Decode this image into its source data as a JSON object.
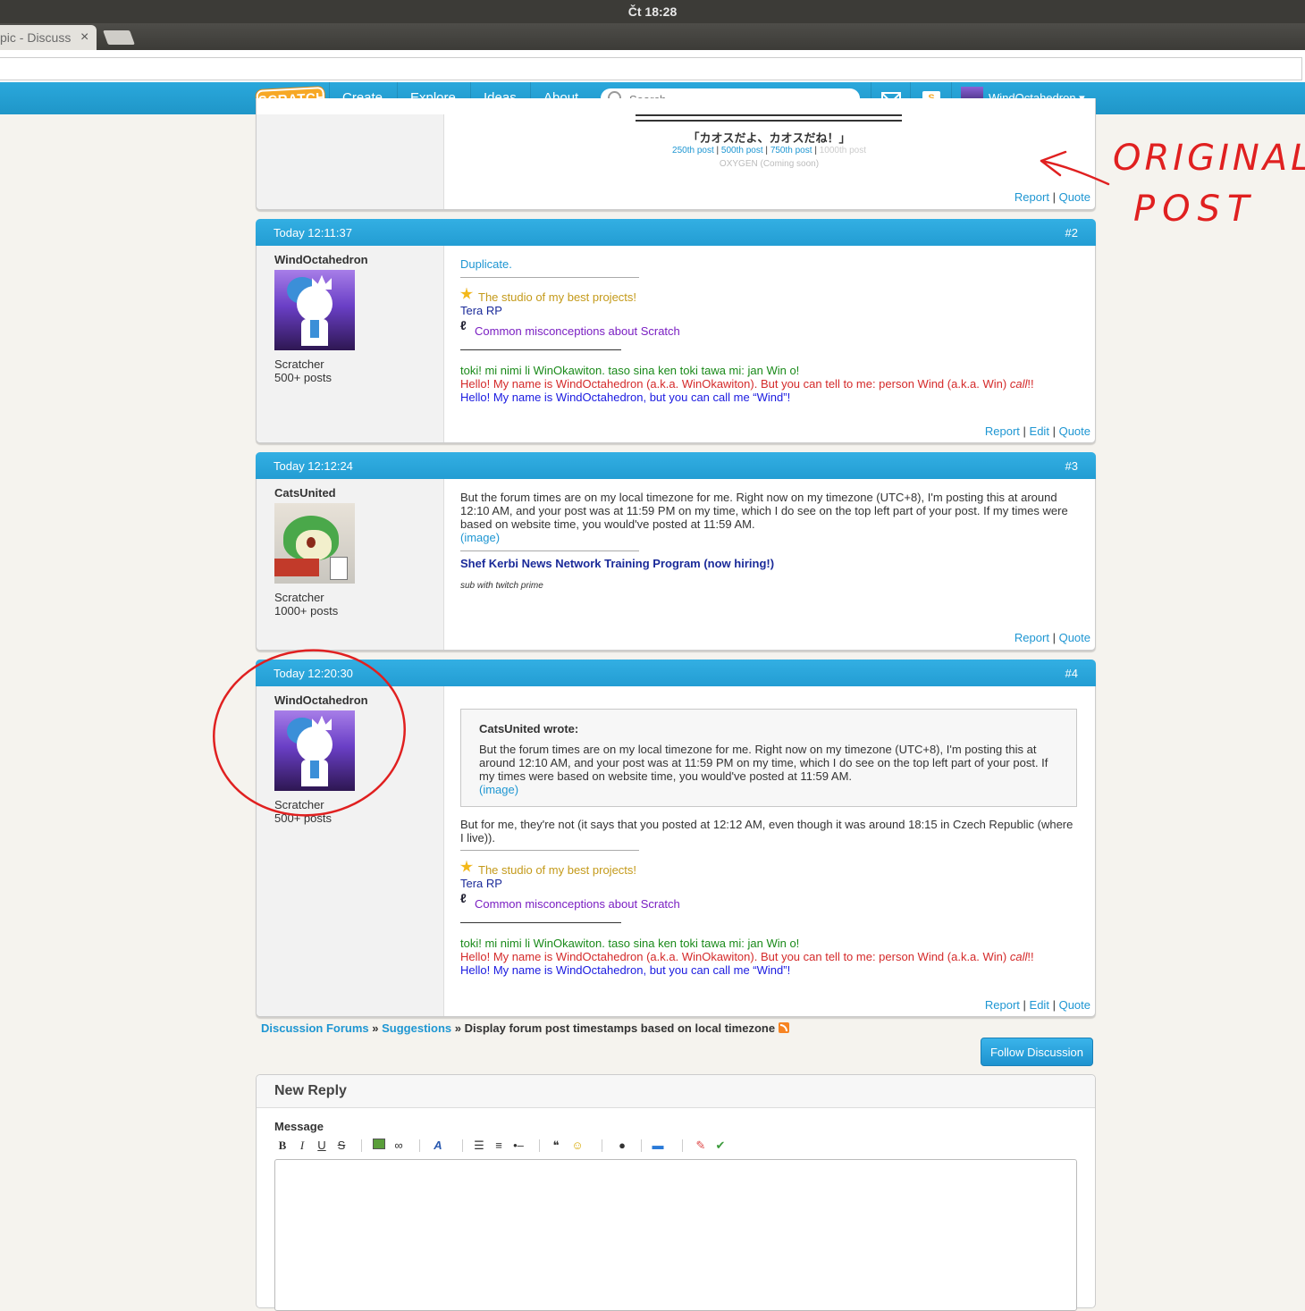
{
  "os_bar": {
    "clock": "Čt 18:28"
  },
  "browser": {
    "tab_title": "pic - Discuss",
    "tab_close": "×"
  },
  "nav": {
    "logo": "SCRATCH",
    "items": [
      "Create",
      "Explore",
      "Ideas",
      "About"
    ],
    "search_placeholder": "Search",
    "user": "WindOctahedron ▾"
  },
  "post1": {
    "signature_title": "「カオスだよ、カオスだね！」",
    "milestones": [
      "250th post",
      "500th post",
      "750th post",
      "1000th post"
    ],
    "milestone_seps": [
      "|",
      "|",
      "|"
    ],
    "oxygen": "OXYGEN (Coming soon)",
    "actions": [
      "Report",
      "Quote"
    ],
    "action_sep": "|"
  },
  "post2": {
    "time": "Today 12:11:37",
    "num": "#2",
    "author": "WindOctahedron",
    "rank": "Scratcher",
    "posts": "500+ posts",
    "message": "Duplicate.",
    "sig_studio": "The studio of my best projects!",
    "sig_tera": "Tera RP",
    "sig_misconceptions": "Common misconceptions about Scratch",
    "sig_toki": "toki! mi nimi li WinOkawiton. taso sina ken toki tawa mi: jan Win o!",
    "sig_hello_red": "Hello! My name is WindOctahedron (a.k.a. WinOkawiton). But you can tell to me: person Wind (a.k.a. Win) ",
    "sig_hello_red_em": "call",
    "sig_hello_red_end": "!!",
    "sig_hello_blue": "Hello! My name is WindOctahedron, but you can call me “Wind”!",
    "actions": [
      "Report",
      "Edit",
      "Quote"
    ],
    "action_sep": "|"
  },
  "post3": {
    "time": "Today 12:12:24",
    "num": "#3",
    "author": "CatsUnited",
    "rank": "Scratcher",
    "posts": "1000+ posts",
    "message": "But the forum times are on my local timezone for me. Right now on my timezone (UTC+8), I'm posting this at around 12:10 AM, and your post was at 11:59 PM on my time, which I do see on the top left part of your post. If my times were based on website time, you would've posted at 11:59 AM.",
    "image_link": "(image)",
    "sig_news": "Shef Kerbi News Network Training Program (now hiring!)",
    "sig_twitch": "sub with twitch prime",
    "actions": [
      "Report",
      "Quote"
    ],
    "action_sep": "|"
  },
  "post4": {
    "time": "Today 12:20:30",
    "num": "#4",
    "author": "WindOctahedron",
    "rank": "Scratcher",
    "posts": "500+ posts",
    "quote_author": "CatsUnited wrote:",
    "quote_text": "But the forum times are on my local timezone for me. Right now on my timezone (UTC+8), I'm posting this at around 12:10 AM, and your post was at 11:59 PM on my time, which I do see on the top left part of your post. If my times were based on website time, you would've posted at 11:59 AM.",
    "quote_image": "(image)",
    "message": "But for me, they're not (it says that you posted at 12:12 AM, even though it was around 18:15 in Czech Republic (where I live)).",
    "sig_studio": "The studio of my best projects!",
    "sig_tera": "Tera RP",
    "sig_misconceptions": "Common misconceptions about Scratch",
    "sig_toki": "toki! mi nimi li WinOkawiton. taso sina ken toki tawa mi: jan Win o!",
    "sig_hello_red": "Hello! My name is WindOctahedron (a.k.a. WinOkawiton). But you can tell to me: person Wind (a.k.a. Win) ",
    "sig_hello_red_em": "call",
    "sig_hello_red_end": "!!",
    "sig_hello_blue": "Hello! My name is WindOctahedron, but you can call me “Wind”!",
    "actions": [
      "Report",
      "Edit",
      "Quote"
    ],
    "action_sep": "|"
  },
  "breadcrumb": {
    "forums": "Discussion Forums",
    "sep1": " » ",
    "suggestions": "Suggestions",
    "sep2": " » ",
    "topic": "Display forum post timestamps based on local timezone"
  },
  "follow_button": "Follow Discussion",
  "reply": {
    "title": "New Reply",
    "message_label": "Message",
    "toolbar": {
      "bold": "B",
      "italic": "I",
      "underline": "U",
      "strike": "S"
    }
  },
  "annotation": {
    "text_line1": "ORIGINAL",
    "text_line2": "POST",
    "color": "#e02020"
  },
  "colors": {
    "accent": "#25aae1",
    "link": "#1e96d2"
  }
}
